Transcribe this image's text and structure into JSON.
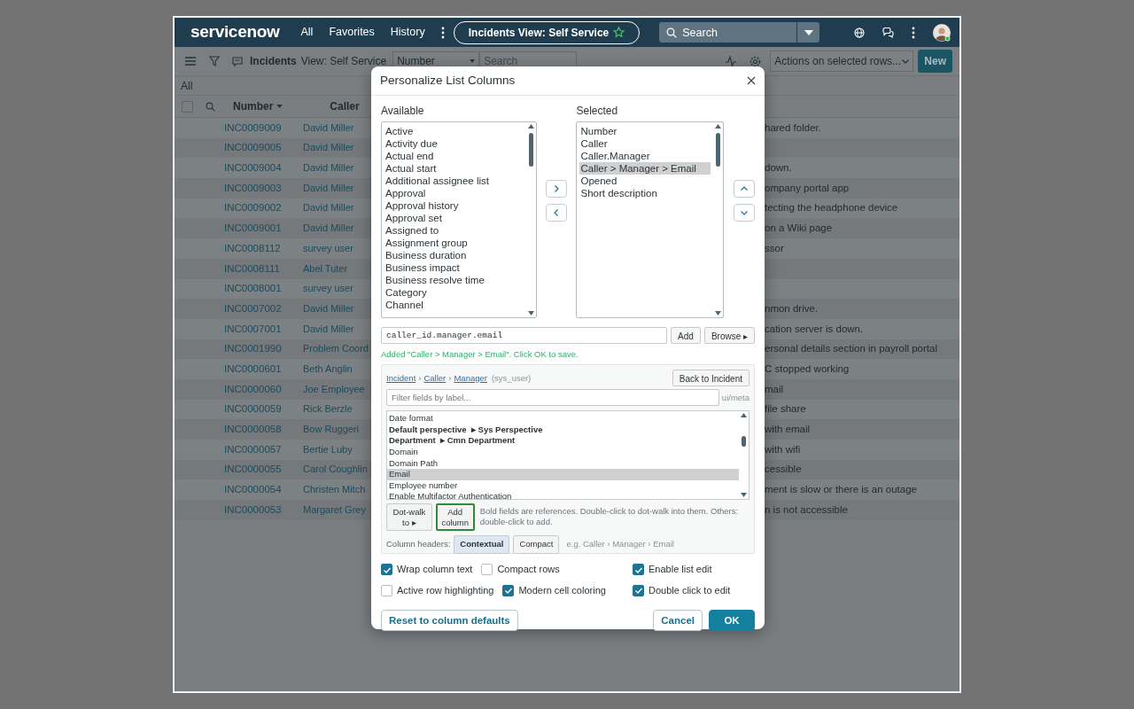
{
  "topbar": {
    "logo": "servicenow",
    "nav": [
      "All",
      "Favorites",
      "History"
    ],
    "context_title": "Incidents View: Self Service",
    "search": {
      "placeholder": "Search"
    }
  },
  "toolbar": {
    "title": "Incidents",
    "view": "View: Self Service",
    "field_select": "Number",
    "search": {
      "placeholder": "Search"
    },
    "actions_select": "Actions on selected rows...",
    "new_button": "New"
  },
  "breadcrumb": "All",
  "table": {
    "select_all": {
      "checked": false
    },
    "columns": [
      "Number",
      "Caller"
    ],
    "rows": [
      {
        "number": "INC0009009",
        "caller": "David Miller",
        "column_3": "hared folder."
      },
      {
        "number": "INC0009005",
        "caller": "David Miller"
      },
      {
        "number": "INC0009004",
        "caller": "David Miller",
        "column_3": "down."
      },
      {
        "number": "INC0009003",
        "caller": "David Miller",
        "column_3": "ompany portal app"
      },
      {
        "number": "INC0009002",
        "caller": "David Miller",
        "column_3": "tecting the headphone device"
      },
      {
        "number": "INC0009001",
        "caller": "David Miller",
        "column_3": "on a Wiki page"
      },
      {
        "number": "INC0008112",
        "caller": "survey user",
        "column_3": "ssor"
      },
      {
        "number": "INC0008111",
        "caller": "Abel Tuter"
      },
      {
        "number": "INC0008001",
        "caller": "survey user"
      },
      {
        "number": "INC0007002",
        "caller": "David Miller",
        "column_3": "nmon drive."
      },
      {
        "number": "INC0007001",
        "caller": "David Miller",
        "column_3": "cation server is down."
      },
      {
        "number": "INC0001990",
        "caller": "Problem Coord",
        "column_3": "ersonal details section in payroll portal"
      },
      {
        "number": "INC0000601",
        "caller": "Beth Anglin",
        "column_3": "C stopped working"
      },
      {
        "number": "INC0000060",
        "caller": "Joe Employee",
        "column_3": "mail"
      },
      {
        "number": "INC0000059",
        "caller": "Rick Berzle",
        "column_3": "file share"
      },
      {
        "number": "INC0000058",
        "caller": "Bow Ruggeri",
        "column_3": "with email"
      },
      {
        "number": "INC0000057",
        "caller": "Bertie Luby",
        "column_3": "with wifi"
      },
      {
        "number": "INC0000055",
        "caller": "Carol Coughlin",
        "column_3": "cessible"
      },
      {
        "number": "INC0000054",
        "caller": "Christen Mitch",
        "column_3": "ment is slow or there is an outage"
      },
      {
        "number": "INC0000053",
        "caller": "Margaret Grey",
        "column_3": "n is not accessible"
      }
    ]
  },
  "dialog": {
    "title": "Personalize List Columns",
    "available": {
      "label": "Available",
      "items": [
        {
          "label": "Active",
          "selected": false
        },
        {
          "label": "Activity due",
          "selected": false
        },
        {
          "label": "Actual end",
          "selected": false
        },
        {
          "label": "Actual start",
          "selected": false
        },
        {
          "label": "Additional assignee list",
          "selected": false
        },
        {
          "label": "Approval",
          "selected": false
        },
        {
          "label": "Approval history",
          "selected": false
        },
        {
          "label": "Approval set",
          "selected": false
        },
        {
          "label": "Assigned to",
          "selected": false
        },
        {
          "label": "Assignment group",
          "selected": false
        },
        {
          "label": "Business duration",
          "selected": false
        },
        {
          "label": "Business impact",
          "selected": false
        },
        {
          "label": "Business resolve time",
          "selected": false
        },
        {
          "label": "Category",
          "selected": false
        },
        {
          "label": "Channel",
          "selected": false
        }
      ]
    },
    "selected": {
      "label": "Selected",
      "items": [
        {
          "label": "Number",
          "selected": false
        },
        {
          "label": "Caller",
          "selected": false
        },
        {
          "label": "Caller.Manager",
          "selected": false
        },
        {
          "label": "Caller > Manager > Email",
          "selected": true
        },
        {
          "label": "Opened",
          "selected": false
        },
        {
          "label": "Short description",
          "selected": false
        }
      ]
    },
    "field_input": {
      "value": "caller_id.manager.email"
    },
    "add_button": "Add",
    "browse_button": "Browse ▸",
    "message": "Added \"Caller > Manager > Email\". Click OK to save.",
    "browser": {
      "path": [
        {
          "label": "Incident"
        },
        {
          "label": "Caller"
        },
        {
          "label": "Manager"
        }
      ],
      "separator": "›",
      "table_name": "(sys_user)",
      "back_button": "Back to Incident",
      "filter": {
        "placeholder": "Filter fields by label..."
      },
      "side_note": "ui/meta",
      "fields": [
        {
          "label": "Date format",
          "kind": "plain",
          "selected": false
        },
        {
          "label": "Default perspective",
          "kind": "reference",
          "target": "▸ Sys Perspective",
          "selected": false
        },
        {
          "label": "Department",
          "kind": "reference",
          "target": "▸ Cmn Department",
          "selected": false
        },
        {
          "label": "Domain",
          "kind": "plain",
          "selected": false
        },
        {
          "label": "Domain Path",
          "kind": "plain",
          "selected": false
        },
        {
          "label": "Email",
          "kind": "plain",
          "selected": true
        },
        {
          "label": "Employee number",
          "kind": "plain",
          "selected": false
        },
        {
          "label": "Enable Multifactor Authentication",
          "kind": "plain",
          "selected": false
        }
      ],
      "dot_walk_button": "Dot-walk to ▸",
      "add_column_button": {
        "label": "Add column",
        "focused": true
      },
      "hint": "Bold fields are references. Double-click to dot-walk into them. Others: double-click to add.",
      "headers_label": "Column headers:",
      "header_modes": [
        {
          "label": "Contextual",
          "selected": true
        },
        {
          "label": "Compact",
          "selected": false
        }
      ],
      "example": "e.g. Caller › Manager › Email"
    },
    "options": [
      {
        "label": "Wrap column text",
        "checked": true
      },
      {
        "label": "Compact rows",
        "checked": false
      },
      {
        "label": "Enable list edit",
        "checked": true
      },
      {
        "label": "Active row highlighting",
        "checked": false
      },
      {
        "label": "Modern cell coloring",
        "checked": true
      },
      {
        "label": "Double click to edit",
        "checked": true
      }
    ],
    "footer": {
      "reset_button": "Reset to column defaults",
      "cancel_button": "Cancel",
      "ok_button": "OK"
    }
  }
}
